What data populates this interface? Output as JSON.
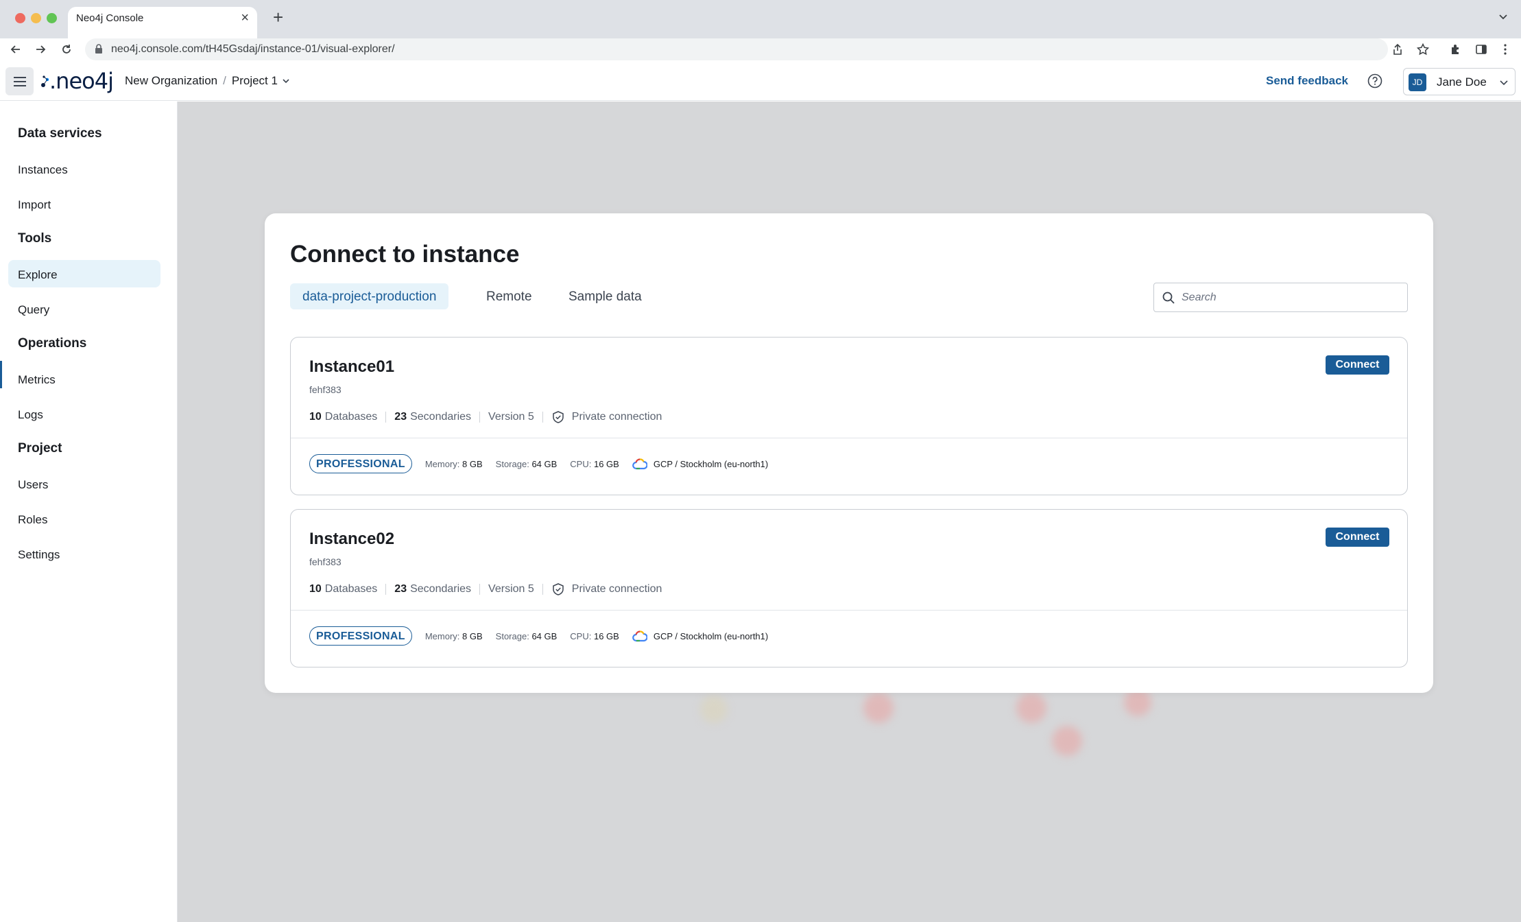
{
  "browser": {
    "tab_title": "Neo4j Console",
    "url": "neo4j.console.com/tH45Gsdaj/instance-01/visual-explorer/"
  },
  "header": {
    "logo_text": ".neo4j",
    "breadcrumb": {
      "org": "New Organization",
      "separator": "/",
      "project": "Project 1"
    },
    "feedback_label": "Send feedback",
    "user": {
      "initials": "JD",
      "name": "Jane Doe"
    }
  },
  "sidebar": {
    "sections": [
      {
        "title": "Data services",
        "items": [
          "Instances",
          "Import"
        ]
      },
      {
        "title": "Tools",
        "items": [
          "Explore",
          "Query"
        ]
      },
      {
        "title": "Operations",
        "items": [
          "Metrics",
          "Logs"
        ]
      },
      {
        "title": "Project",
        "items": [
          "Users",
          "Roles",
          "Settings"
        ]
      }
    ],
    "active_item": "Explore"
  },
  "modal": {
    "title": "Connect to instance",
    "tabs": [
      "data-project-production",
      "Remote",
      "Sample data"
    ],
    "active_tab": "data-project-production",
    "search_placeholder": "Search",
    "instances": [
      {
        "name": "Instance01",
        "id": "fehf383",
        "databases_count": "10",
        "databases_label": "Databases",
        "secondaries_count": "23",
        "secondaries_label": "Secondaries",
        "version": "Version 5",
        "connection": "Private connection",
        "connect_label": "Connect",
        "tier": "PROFESSIONAL",
        "memory_label": "Memory:",
        "memory": "8 GB",
        "storage_label": "Storage:",
        "storage": "64 GB",
        "cpu_label": "CPU:",
        "cpu": "16 GB",
        "region": "GCP / Stockholm (eu-north1)"
      },
      {
        "name": "Instance02",
        "id": "fehf383",
        "databases_count": "10",
        "databases_label": "Databases",
        "secondaries_count": "23",
        "secondaries_label": "Secondaries",
        "version": "Version 5",
        "connection": "Private connection",
        "connect_label": "Connect",
        "tier": "PROFESSIONAL",
        "memory_label": "Memory:",
        "memory": "8 GB",
        "storage_label": "Storage:",
        "storage": "64 GB",
        "cpu_label": "CPU:",
        "cpu": "16 GB",
        "region": "GCP / Stockholm (eu-north1)"
      }
    ]
  },
  "colors": {
    "accent": "#1a5c97",
    "active_bg": "#e6f3fa",
    "backdrop": "#d6d7d9"
  }
}
